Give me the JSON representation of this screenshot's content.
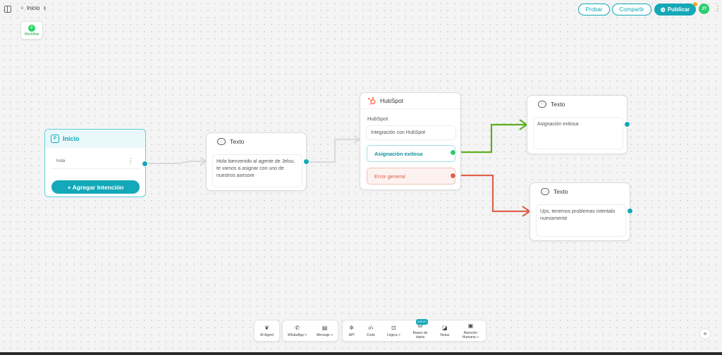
{
  "topbar": {
    "flow_name": "Inicio",
    "buttons": {
      "test": "Probar",
      "share": "Compartir",
      "publish": "Publicar"
    },
    "avatar_initials": "JT"
  },
  "workflow_badge": {
    "label": "Workflow"
  },
  "start_node": {
    "title": "Inicio",
    "intent": "hola",
    "add_intent": "+ Agregar Intención"
  },
  "text_node_1": {
    "title": "Texto",
    "body": "Hola bienvenido al agente de Jelou, te vamos a asignar con uno de nuestros asesore"
  },
  "hubspot_node": {
    "title": "HubSpot",
    "subtitle": "HubSpot",
    "description": "Integración con HubSpot",
    "success": "Asignación exitosa",
    "error": "Error general"
  },
  "text_node_2": {
    "title": "Texto",
    "body": "Asignación exitosa"
  },
  "text_node_3": {
    "title": "Texto",
    "body": "Ups, tenemos problemas intentalo nuevamente"
  },
  "toolbar": {
    "ai_agent": "AI Agent",
    "whatsapp": "WhatsApp >",
    "message": "Mensaje >",
    "api": "API",
    "code": "Code",
    "logic": "Lógica >",
    "databases": "Bases de datos",
    "new_tag": "NUEVO",
    "notes": "Notas",
    "human": "Atención Humana >"
  },
  "colors": {
    "accent": "#14a8b8",
    "success_edge": "#5cae1f",
    "error_edge": "#e0604b"
  }
}
